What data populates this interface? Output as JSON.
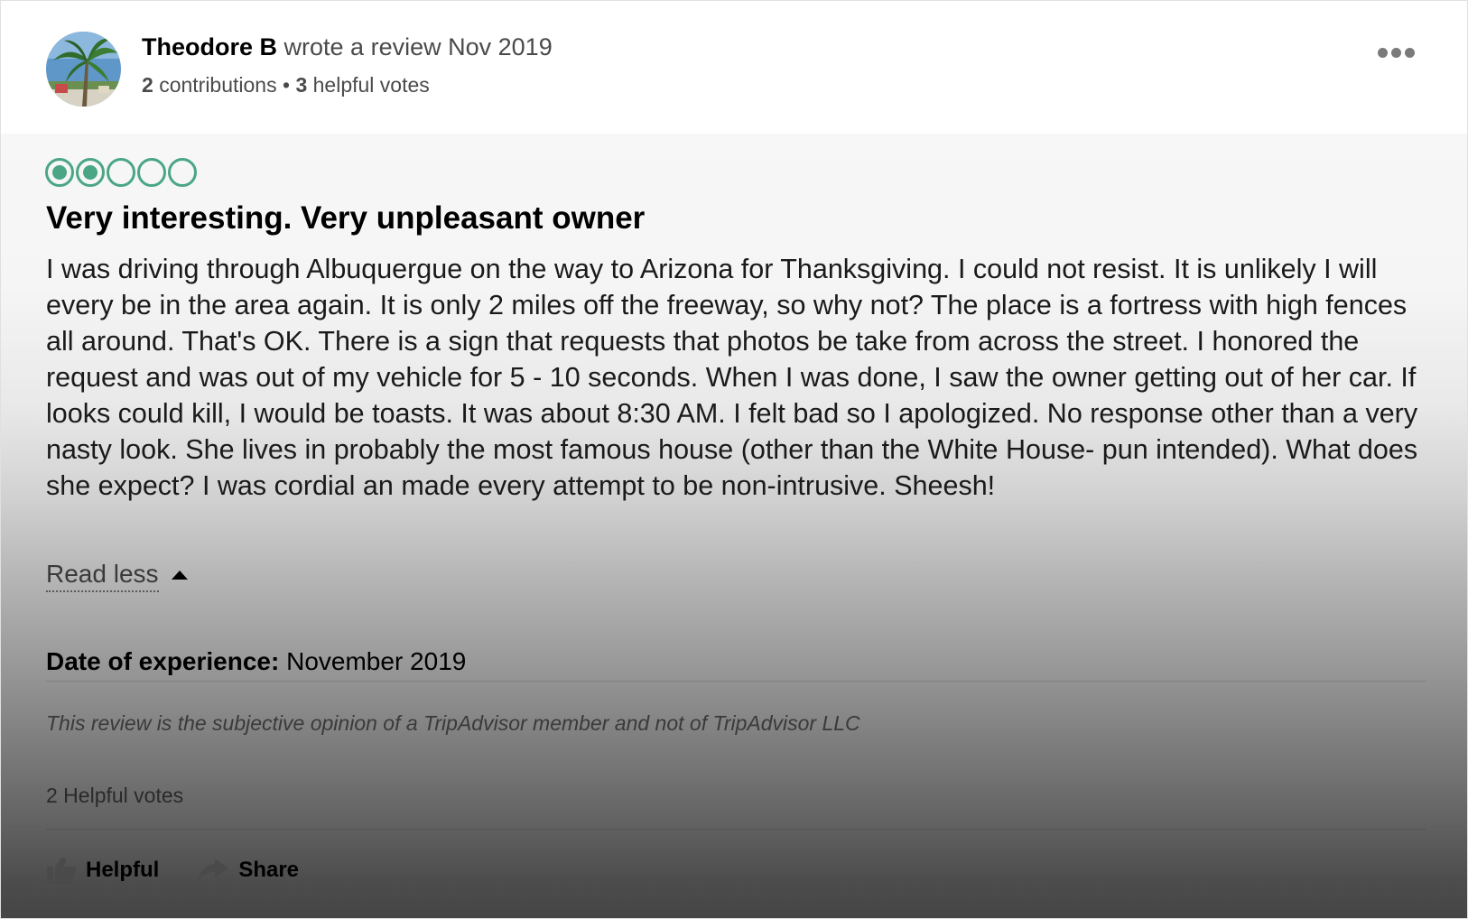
{
  "review": {
    "author": {
      "name": "Theodore B",
      "action_text": "wrote a review",
      "date": "Nov 2019",
      "contributions_count": "2",
      "contributions_label": "contributions",
      "separator": "•",
      "helpful_votes_count": "3",
      "helpful_votes_label": "helpful votes",
      "avatar_icon": "palm-beach-avatar"
    },
    "more_menu_icon": "more-dots-icon",
    "rating": {
      "value": 2,
      "max": 5,
      "bubble_color": "#4aa685"
    },
    "title": "Very interesting. Very unpleasant owner",
    "text": "I was driving through Albuquergue on the way to Arizona for Thanksgiving. I could not resist. It is unlikely I will every be in the area again. It is only 2 miles off the freeway, so why not? The place is a fortress with high fences all around. That's OK. There is a sign that requests that photos be take from across the street. I honored the request and was out of my vehicle for 5 - 10 seconds. When I was done, I saw the owner getting out of her car. If looks could kill, I would be toasts. It was about 8:30 AM. I felt bad so I apologized. No response other than a very nasty look. She lives in probably the most famous house (other than the White House- pun intended). What does she expect? I was cordial an made every attempt to be non-intrusive. Sheesh!",
    "read_less_label": "Read less",
    "date_of_experience_label": "Date of experience:",
    "date_of_experience_value": "November 2019",
    "disclaimer": "This review is the subjective opinion of a TripAdvisor member and not of TripAdvisor LLC",
    "helpful_votes_text": "2 Helpful votes",
    "actions": {
      "helpful_label": "Helpful",
      "helpful_icon": "thumbs-up-icon",
      "share_label": "Share",
      "share_icon": "share-arrow-icon"
    }
  }
}
